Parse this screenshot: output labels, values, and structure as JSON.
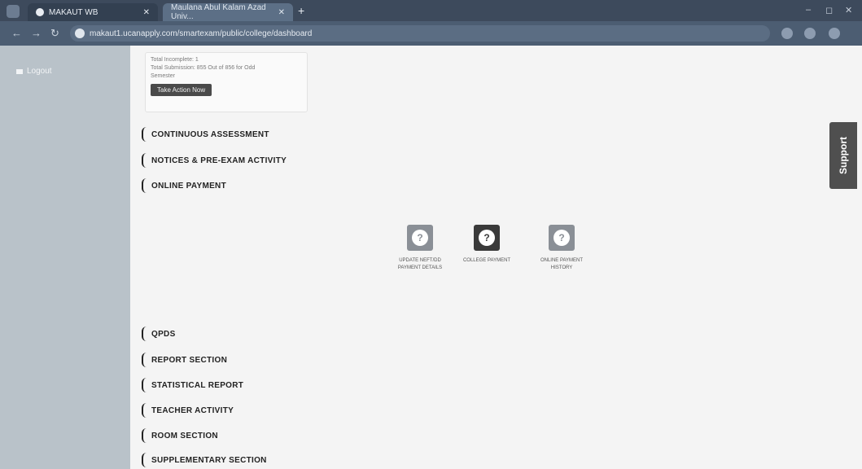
{
  "browser": {
    "tabs": [
      {
        "title": "MAKAUT WB"
      },
      {
        "title": "Maulana Abul Kalam Azad Univ..."
      }
    ],
    "url": "makaut1.ucanapply.com/smartexam/public/college/dashboard"
  },
  "sidebar": {
    "items": [
      {
        "label": "Logout"
      }
    ]
  },
  "info_box": {
    "line1": "Total Incomplete: 1",
    "line2": "Total Submission: 855 Out of 856 for Odd",
    "line3": "Semester",
    "button_label": "Take Action Now"
  },
  "sections_top": [
    {
      "label": "CONTINUOUS ASSESSMENT"
    },
    {
      "label": "NOTICES & PRE-EXAM ACTIVITY"
    },
    {
      "label": "ONLINE PAYMENT"
    }
  ],
  "payment_tiles": [
    {
      "label_line1": "UPDATE NEFT/DD",
      "label_line2": "PAYMENT DETAILS",
      "icon": "question-bubble-icon"
    },
    {
      "label_line1": "COLLEGE PAYMENT",
      "label_line2": "",
      "icon": "question-bubble-icon"
    },
    {
      "label_line1": "ONLINE PAYMENT",
      "label_line2": "HISTORY",
      "icon": "question-bubble-icon"
    }
  ],
  "sections_bottom": [
    {
      "label": "QPDS"
    },
    {
      "label": "REPORT SECTION"
    },
    {
      "label": "STATISTICAL REPORT"
    },
    {
      "label": "TEACHER ACTIVITY"
    },
    {
      "label": "ROOM SECTION"
    },
    {
      "label": "SUPPLEMENTARY SECTION"
    }
  ],
  "support": {
    "label": "Support"
  },
  "colors": {
    "tile_light": "#8a8f96",
    "tile_dark": "#3a3a3a",
    "support_bg": "#4f4f4f",
    "sidebar_bg": "#b9c2c9"
  }
}
